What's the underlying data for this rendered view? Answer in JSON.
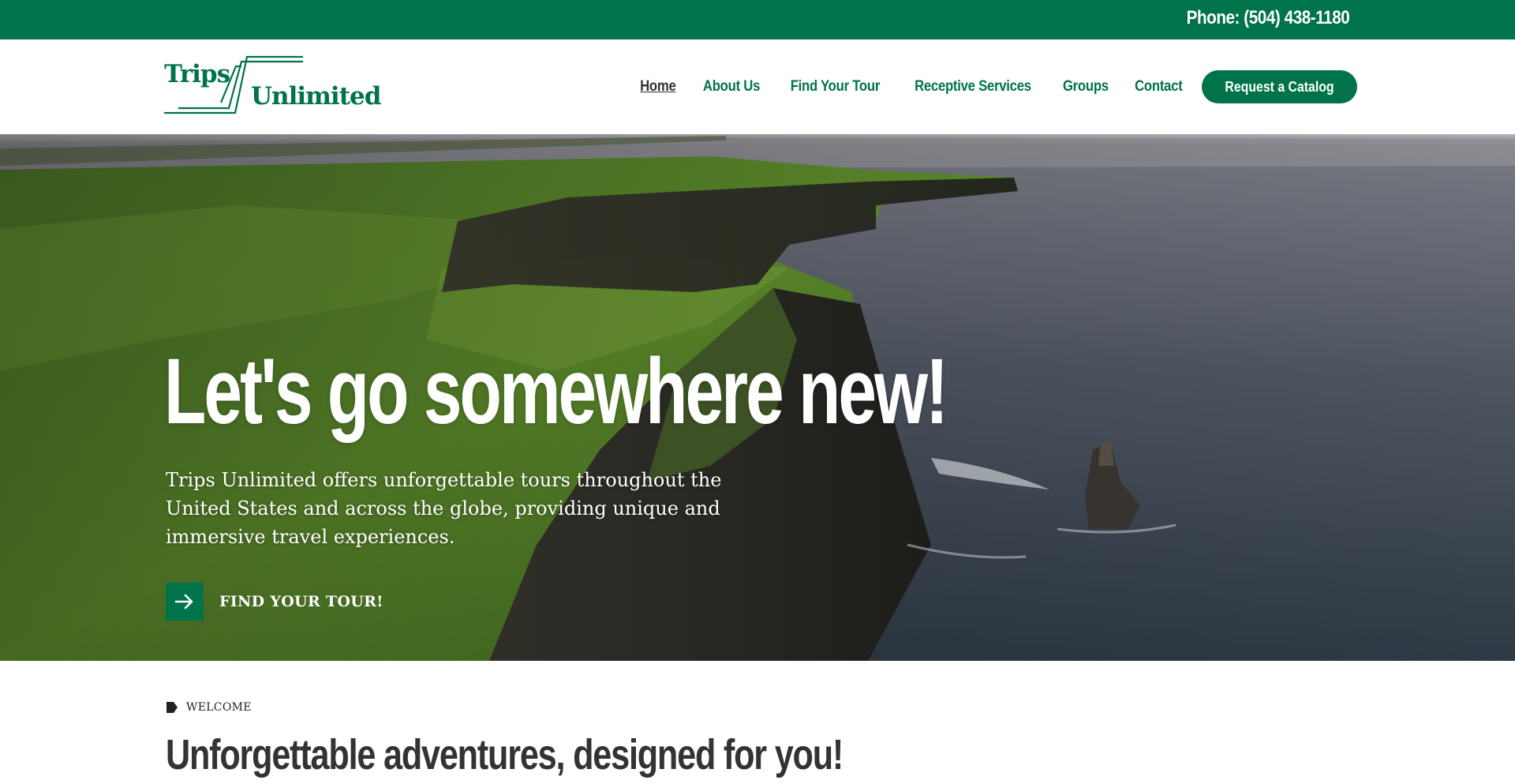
{
  "topbar": {
    "phone": "Phone: (504) 438-1180"
  },
  "brand": {
    "word1": "Trips",
    "word2": "Unlimited",
    "color": "#00734a"
  },
  "nav": {
    "items": [
      {
        "label": "Home",
        "active": true
      },
      {
        "label": "About Us"
      },
      {
        "label": "Find Your Tour"
      },
      {
        "label": "Receptive Services"
      },
      {
        "label": "Groups"
      },
      {
        "label": "Contact"
      }
    ],
    "cta_label": "Request a Catalog"
  },
  "hero": {
    "title": "Let's go somewhere new!",
    "text": "Trips Unlimited offers unforgettable tours throughout the United States and across the globe, providing unique and immersive travel experiences.",
    "cta_label": "FIND YOUR TOUR!",
    "cta_icon": "arrow-right-icon"
  },
  "welcome": {
    "eyebrow": "WELCOME",
    "eyebrow_icon": "tag-icon",
    "title": "Unforgettable adventures, designed for you!"
  }
}
